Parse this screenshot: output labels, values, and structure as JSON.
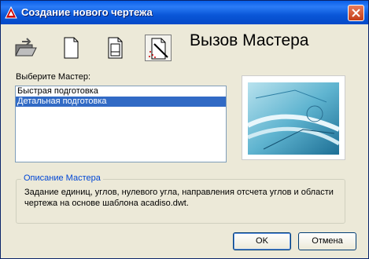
{
  "window": {
    "title": "Создание нового чертежа"
  },
  "toolbar": {
    "buttons": [
      {
        "icon": "open-folder-icon"
      },
      {
        "icon": "blank-document-icon"
      },
      {
        "icon": "template-document-icon"
      },
      {
        "icon": "wizard-icon",
        "active": true
      }
    ]
  },
  "heading": "Вызов Мастера",
  "wizard_list": {
    "label": "Выберите Мастер:",
    "items": [
      {
        "label": "Быстрая подготовка",
        "selected": false
      },
      {
        "label": "Детальная подготовка",
        "selected": true
      }
    ]
  },
  "description": {
    "title": "Описание Мастера",
    "text": "Задание единиц, углов, нулевого угла, направления отсчета углов и области чертежа на основе шаблона acadiso.dwt."
  },
  "buttons": {
    "ok_label": "OK",
    "cancel_label": "Отмена"
  },
  "colors": {
    "titlebar": "#0a57d8",
    "selection": "#316ac5",
    "group_title": "#0046d5"
  }
}
